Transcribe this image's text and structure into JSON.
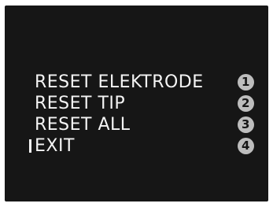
{
  "menu": {
    "items": [
      {
        "label": "RESET ELEKTRODE",
        "number": "1",
        "selected": false
      },
      {
        "label": "RESET TIP",
        "number": "2",
        "selected": false
      },
      {
        "label": "RESET ALL",
        "number": "3",
        "selected": false
      },
      {
        "label": "EXIT",
        "number": "4",
        "selected": true
      }
    ]
  },
  "colors": {
    "screen_background": "#161616",
    "text": "#f4f4f4",
    "badge_background": "#bdbdbd"
  }
}
